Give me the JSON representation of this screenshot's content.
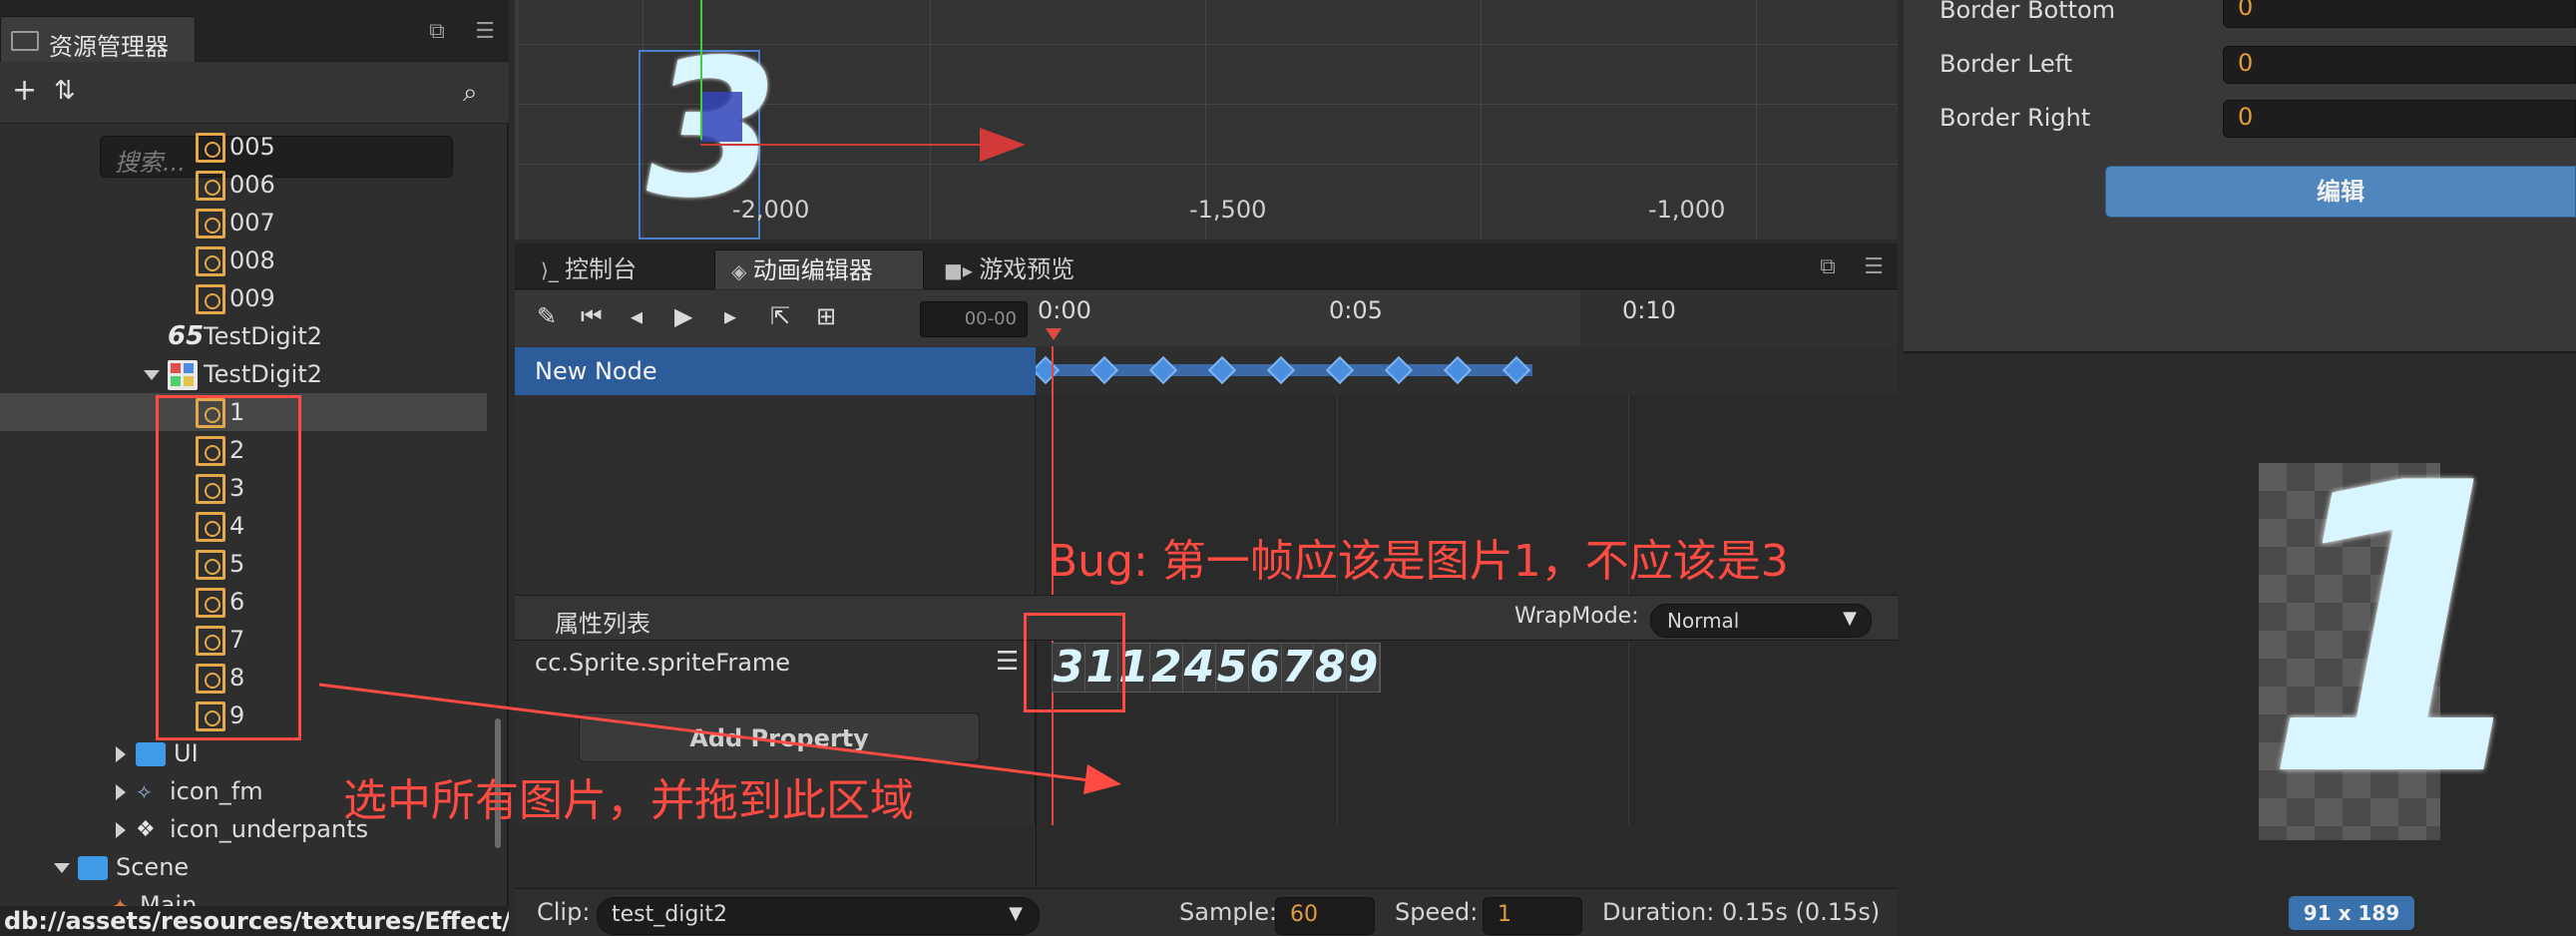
{
  "assets_panel": {
    "tab_label": "资源管理器",
    "search_placeholder": "搜索...",
    "tree": [
      {
        "label": "005",
        "type": "sprite"
      },
      {
        "label": "006",
        "type": "sprite"
      },
      {
        "label": "007",
        "type": "sprite"
      },
      {
        "label": "008",
        "type": "sprite"
      },
      {
        "label": "009",
        "type": "sprite"
      },
      {
        "label": "TestDigit2",
        "type": "font"
      },
      {
        "label": "TestDigit2",
        "type": "atlas"
      },
      {
        "label": "1",
        "type": "sprite"
      },
      {
        "label": "2",
        "type": "sprite"
      },
      {
        "label": "3",
        "type": "sprite"
      },
      {
        "label": "4",
        "type": "sprite"
      },
      {
        "label": "5",
        "type": "sprite"
      },
      {
        "label": "6",
        "type": "sprite"
      },
      {
        "label": "7",
        "type": "sprite"
      },
      {
        "label": "8",
        "type": "sprite"
      },
      {
        "label": "9",
        "type": "sprite"
      },
      {
        "label": "UI",
        "type": "folder"
      },
      {
        "label": "icon_fm",
        "type": "particle"
      },
      {
        "label": "icon_underpants",
        "type": "particle"
      },
      {
        "label": "Scene",
        "type": "folder"
      },
      {
        "label": "Main",
        "type": "scene"
      }
    ],
    "status_path": "db://assets/resources/textures/Effect/..."
  },
  "scene_view": {
    "ruler_labels": [
      "-2,000",
      "-1,500",
      "-1,000"
    ],
    "digit_glyph": "3"
  },
  "anim_editor": {
    "tabs": [
      "控制台",
      "动画编辑器",
      "游戏预览"
    ],
    "time_field": "00-00",
    "timeline_labels": [
      "0:00",
      "0:05",
      "0:10"
    ],
    "node_name": "New Node",
    "prop_list_label": "属性列表",
    "wrapmode_label": "WrapMode:",
    "wrapmode_value": "Normal",
    "property": "cc.Sprite.spriteFrame",
    "add_property": "Add Property",
    "frame_strip": [
      "3",
      "1",
      "1",
      "2",
      "4",
      "5",
      "6",
      "7",
      "8",
      "9"
    ],
    "clip_label": "Clip:",
    "clip_value": "test_digit2",
    "sample_label": "Sample:",
    "sample_value": "60",
    "speed_label": "Speed:",
    "speed_value": "1",
    "duration": "Duration: 0.15s (0.15s)"
  },
  "inspector": {
    "rows": [
      {
        "label": "Border Bottom",
        "value": "0"
      },
      {
        "label": "Border Left",
        "value": "0"
      },
      {
        "label": "Border Right",
        "value": "0"
      }
    ],
    "edit_button": "编辑"
  },
  "preview": {
    "digit": "1",
    "size": "91 x 189"
  },
  "annotations": {
    "bug_note": "Bug: 第一帧应该是图片1，不应该是3",
    "drag_note": "选中所有图片，并拖到此区域"
  },
  "colors": {
    "accent_blue": "#2d5c9a",
    "annotation_red": "#ff4b41",
    "value_orange": "#e39b3b"
  }
}
